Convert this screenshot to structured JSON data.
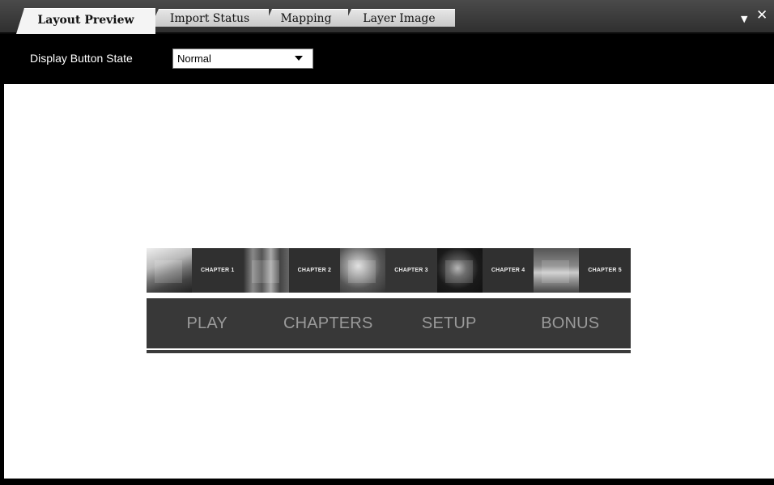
{
  "tabs": [
    {
      "label": "Layout Preview",
      "active": true
    },
    {
      "label": "Import Status",
      "active": false
    },
    {
      "label": "Mapping",
      "active": false
    },
    {
      "label": "Layer Image",
      "active": false
    }
  ],
  "window_controls": {
    "dropdown_icon": "dropdown-arrow-icon",
    "close_icon": "close-icon",
    "dropdown_glyph": "▼",
    "close_glyph": "✕"
  },
  "toolbar": {
    "label": "Display Button State",
    "select_value": "Normal"
  },
  "menu": {
    "chapters": [
      {
        "label": "CHAPTER 1"
      },
      {
        "label": "CHAPTER 2"
      },
      {
        "label": "CHAPTER 3"
      },
      {
        "label": "CHAPTER 4"
      },
      {
        "label": "CHAPTER 5"
      }
    ],
    "buttons": [
      "PLAY",
      "CHAPTERS",
      "SETUP",
      "BONUS"
    ]
  },
  "colors": {
    "background": "#000000",
    "canvas": "#ffffff",
    "menu_panel": "#383838",
    "menu_text": "#9a9a9a"
  }
}
